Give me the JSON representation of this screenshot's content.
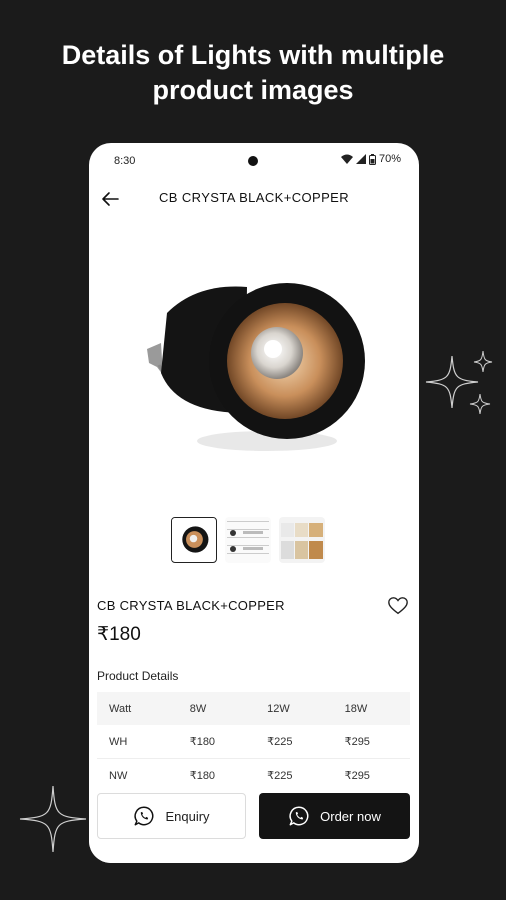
{
  "promo": {
    "line1": "Details of Lights with multiple",
    "line2": "product images"
  },
  "status_bar": {
    "time": "8:30",
    "battery": "70%"
  },
  "app_bar": {
    "title": "CB CRYSTA BLACK+COPPER"
  },
  "product": {
    "name": "CB CRYSTA BLACK+COPPER",
    "price": "₹180",
    "thumbnail_count": 3,
    "selected_thumbnail": 1
  },
  "details": {
    "section_title": "Product Details",
    "columns": [
      "Watt",
      "8W",
      "12W",
      "18W"
    ],
    "rows": [
      [
        "WH",
        "₹180",
        "₹225",
        "₹295"
      ],
      [
        "NW",
        "₹180",
        "₹225",
        "₹295"
      ]
    ]
  },
  "actions": {
    "enquiry": "Enquiry",
    "order": "Order now"
  },
  "colors": {
    "background": "#1b1b1b",
    "primary_button": "#141414",
    "copper": "#c98f5b"
  },
  "icons": [
    "back-arrow-icon",
    "heart-icon",
    "whatsapp-icon",
    "wifi-icon",
    "signal-icon",
    "battery-icon",
    "sparkle-icon"
  ]
}
